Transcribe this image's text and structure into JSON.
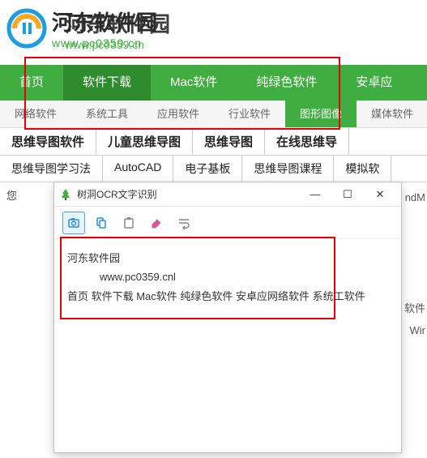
{
  "site": {
    "name": "河东软件园",
    "url": "www.pc0359.cn",
    "wm_name": "河东软件园",
    "wm_url": "www.pc0359.cn"
  },
  "nav_main": [
    "首页",
    "软件下载",
    "Mac软件",
    "纯绿色软件",
    "安卓应"
  ],
  "nav_main_active": 1,
  "nav_sub": [
    "网络软件",
    "系统工具",
    "应用软件",
    "行业软件",
    "图形图像",
    "媒体软件"
  ],
  "nav_sub_active": 4,
  "tags_row1": [
    "思维导图软件",
    "儿童思维导图",
    "思维导图",
    "在线思维导"
  ],
  "tags_row2": [
    "思维导图学习法",
    "AutoCAD",
    "电子基板",
    "思维导图课程",
    "模拟软"
  ],
  "prompt": "您",
  "ocr": {
    "title": "树洞OCR文字识别",
    "line1": "河东软件园",
    "line2": "www.pc0359.cnl",
    "line3": "首页  软件下载  Mac软件  纯绿色软件  安卓应网络软件  系统工软件"
  },
  "bg": {
    "t1": "ndM",
    "t2": "软件",
    "t3": "Wir"
  },
  "win_btns": {
    "min": "—",
    "max": "☐",
    "close": "✕"
  }
}
